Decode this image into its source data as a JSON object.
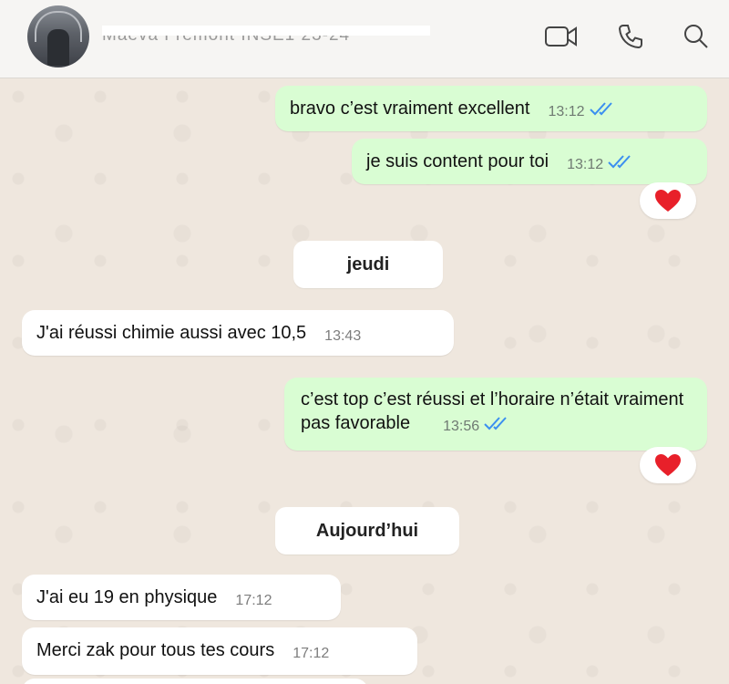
{
  "header": {
    "contact_name": "Maeva Fremont INSE1 23-24",
    "icons": [
      "video-call-icon",
      "phone-icon",
      "search-icon"
    ]
  },
  "messages": [
    {
      "direction": "out",
      "text": "bravo c’est vraiment excellent",
      "time": "13:12",
      "status": "read"
    },
    {
      "direction": "out",
      "text": "je suis content pour toi",
      "time": "13:12",
      "status": "read",
      "reaction": "heart"
    },
    {
      "type": "date",
      "label": "jeudi"
    },
    {
      "direction": "in",
      "text": "J'ai réussi chimie aussi avec 10,5",
      "time": "13:43"
    },
    {
      "direction": "out",
      "text": "c’est top c’est réussi et l’horaire n’était vraiment pas favorable",
      "time": "13:56",
      "status": "read",
      "reaction": "heart"
    },
    {
      "type": "date",
      "label": "Aujourd’hui"
    },
    {
      "direction": "in",
      "text": "J'ai eu 19 en physique",
      "time": "17:12"
    },
    {
      "direction": "in",
      "text": "Merci zak pour tous tes cours",
      "time": "17:12"
    }
  ],
  "colors": {
    "outgoing_bubble": "#d9fdd3",
    "incoming_bubble": "#ffffff",
    "read_ticks": "#3b8ff0",
    "chat_background": "#efe7de"
  }
}
